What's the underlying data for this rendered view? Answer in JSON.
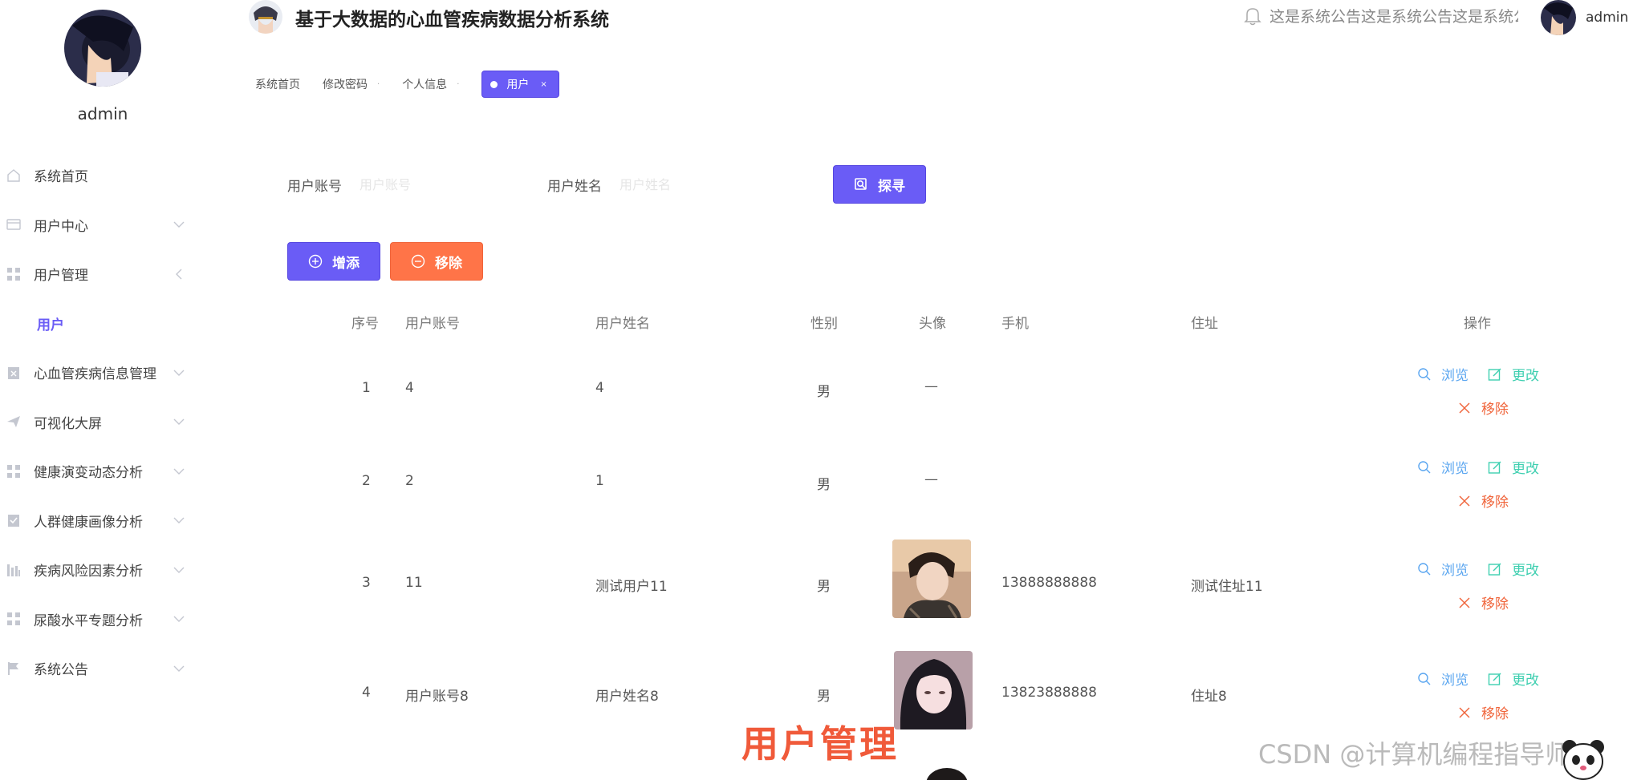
{
  "sidebar": {
    "profile_name": "admin",
    "items": [
      {
        "label": "系统首页",
        "icon": "home-icon"
      },
      {
        "label": "用户中心",
        "icon": "card-icon"
      },
      {
        "label": "用户管理",
        "icon": "grid-icon"
      },
      {
        "label": "用户",
        "icon": ""
      },
      {
        "label": "心血管疾病信息管理",
        "icon": "clipboard-icon"
      },
      {
        "label": "可视化大屏",
        "icon": "send-icon"
      },
      {
        "label": "健康演变动态分析",
        "icon": "grid-icon"
      },
      {
        "label": "人群健康画像分析",
        "icon": "check-clipboard-icon"
      },
      {
        "label": "疾病风险因素分析",
        "icon": "bar-chart-icon"
      },
      {
        "label": "尿酸水平专题分析",
        "icon": "grid-icon"
      },
      {
        "label": "系统公告",
        "icon": "flag-icon"
      }
    ]
  },
  "header": {
    "title": "基于大数据的心血管疾病数据分析系统",
    "notice": "这是系统公告这是系统公告这是系统公告",
    "username": "admin"
  },
  "tabs": [
    {
      "label": "系统首页"
    },
    {
      "label": "修改密码"
    },
    {
      "label": "个人信息"
    },
    {
      "label": "用户",
      "close": "×"
    }
  ],
  "search": {
    "account_label": "用户账号",
    "account_placeholder": "用户账号",
    "name_label": "用户姓名",
    "name_placeholder": "用户姓名",
    "search_button": "探寻"
  },
  "actions": {
    "add_button": "增添",
    "delete_button": "移除"
  },
  "table": {
    "headers": [
      "序号",
      "用户账号",
      "用户姓名",
      "性别",
      "头像",
      "手机",
      "住址",
      "操作"
    ],
    "rows": [
      {
        "index": "1",
        "account": "4",
        "name": "4",
        "gender": "男",
        "avatar": "—",
        "phone": "",
        "address": ""
      },
      {
        "index": "2",
        "account": "2",
        "name": "1",
        "gender": "男",
        "avatar": "—",
        "phone": "",
        "address": ""
      },
      {
        "index": "3",
        "account": "11",
        "name": "测试用户11",
        "gender": "男",
        "avatar": "",
        "phone": "13888888888",
        "address": "测试住址11"
      },
      {
        "index": "4",
        "account": "用户账号8",
        "name": "用户姓名8",
        "gender": "男",
        "avatar": "",
        "phone": "13823888888",
        "address": "住址8"
      }
    ],
    "ops": {
      "view": "浏览",
      "edit": "更改",
      "delete": "移除"
    }
  },
  "overlay": {
    "caption": "用户管理",
    "watermark": "CSDN @计算机编程指导师"
  },
  "colors": {
    "primary": "#6a5cf6",
    "danger": "#ff7448",
    "view": "#5ba6f0",
    "edit": "#3ecfb0"
  }
}
